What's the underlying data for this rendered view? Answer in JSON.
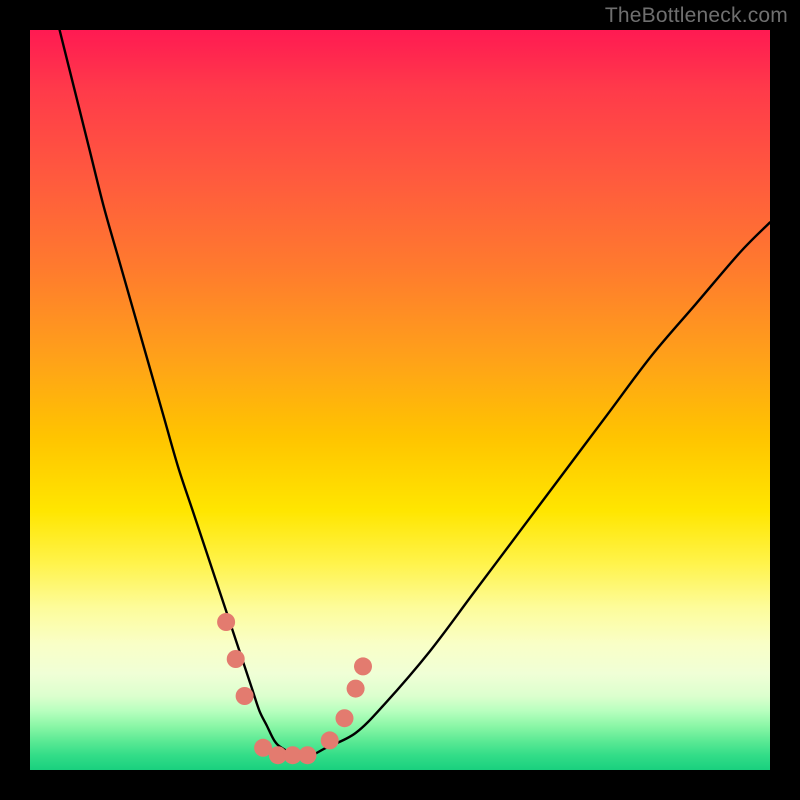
{
  "watermark": "TheBottleneck.com",
  "chart_data": {
    "type": "line",
    "title": "",
    "xlabel": "",
    "ylabel": "",
    "xlim": [
      0,
      100
    ],
    "ylim": [
      0,
      100
    ],
    "series": [
      {
        "name": "curve",
        "x": [
          4,
          6,
          8,
          10,
          12,
          14,
          16,
          18,
          20,
          22,
          24,
          26,
          28,
          29,
          30,
          31,
          32,
          33,
          34,
          36,
          38,
          40,
          44,
          48,
          54,
          60,
          66,
          72,
          78,
          84,
          90,
          96,
          100
        ],
        "y": [
          100,
          92,
          84,
          76,
          69,
          62,
          55,
          48,
          41,
          35,
          29,
          23,
          17,
          14,
          11,
          8,
          6,
          4,
          3,
          2,
          2,
          3,
          5,
          9,
          16,
          24,
          32,
          40,
          48,
          56,
          63,
          70,
          74
        ]
      }
    ],
    "markers": [
      {
        "x": 26.5,
        "y": 20
      },
      {
        "x": 27.8,
        "y": 15
      },
      {
        "x": 29.0,
        "y": 10
      },
      {
        "x": 31.5,
        "y": 3
      },
      {
        "x": 33.5,
        "y": 2
      },
      {
        "x": 35.5,
        "y": 2
      },
      {
        "x": 37.5,
        "y": 2
      },
      {
        "x": 40.5,
        "y": 4
      },
      {
        "x": 42.5,
        "y": 7
      },
      {
        "x": 44.0,
        "y": 11
      },
      {
        "x": 45.0,
        "y": 14
      }
    ],
    "marker_color": "#e37b6f",
    "curve_color": "#000000"
  }
}
